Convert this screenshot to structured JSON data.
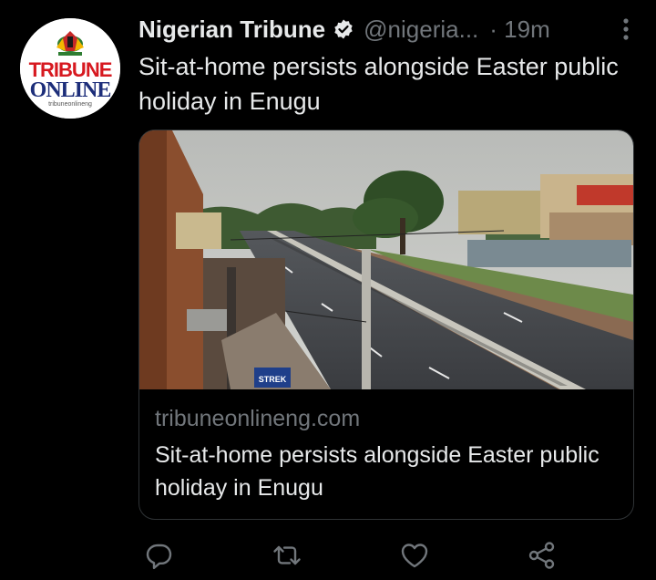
{
  "tweet": {
    "author_name": "Nigerian Tribune",
    "handle": "@nigeria...",
    "time": "· 19m",
    "text": "Sit-at-home persists alongside Easter public holiday in Enugu"
  },
  "avatar": {
    "brand_top": "TRIBUNE",
    "brand_bottom": "ONLINE",
    "brand_url": "tribuneonlineng"
  },
  "card": {
    "domain": "tribuneonlineng.com",
    "title": "Sit-at-home persists alongside Easter public holiday in Enugu",
    "image_sign_text": "STREK"
  },
  "icons": {
    "verified": "verified-badge-icon",
    "more": "more-options-icon",
    "reply": "reply-icon",
    "retweet": "retweet-icon",
    "like": "like-icon",
    "share": "share-icon"
  },
  "colors": {
    "background": "#000000",
    "primary_text": "#e7e9ea",
    "secondary_text": "#71767b",
    "border": "#2f3336",
    "brand_red": "#d71920",
    "brand_blue": "#1d2e7a"
  }
}
